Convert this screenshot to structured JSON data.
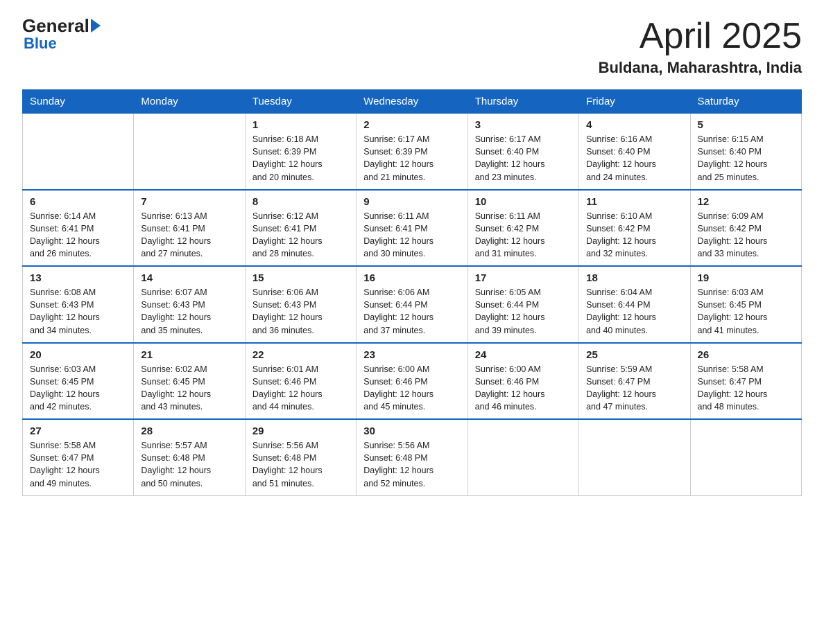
{
  "header": {
    "logo_general": "General",
    "logo_blue": "Blue",
    "title": "April 2025",
    "location": "Buldana, Maharashtra, India"
  },
  "calendar": {
    "days_of_week": [
      "Sunday",
      "Monday",
      "Tuesday",
      "Wednesday",
      "Thursday",
      "Friday",
      "Saturday"
    ],
    "weeks": [
      [
        {
          "day": "",
          "info": ""
        },
        {
          "day": "",
          "info": ""
        },
        {
          "day": "1",
          "info": "Sunrise: 6:18 AM\nSunset: 6:39 PM\nDaylight: 12 hours\nand 20 minutes."
        },
        {
          "day": "2",
          "info": "Sunrise: 6:17 AM\nSunset: 6:39 PM\nDaylight: 12 hours\nand 21 minutes."
        },
        {
          "day": "3",
          "info": "Sunrise: 6:17 AM\nSunset: 6:40 PM\nDaylight: 12 hours\nand 23 minutes."
        },
        {
          "day": "4",
          "info": "Sunrise: 6:16 AM\nSunset: 6:40 PM\nDaylight: 12 hours\nand 24 minutes."
        },
        {
          "day": "5",
          "info": "Sunrise: 6:15 AM\nSunset: 6:40 PM\nDaylight: 12 hours\nand 25 minutes."
        }
      ],
      [
        {
          "day": "6",
          "info": "Sunrise: 6:14 AM\nSunset: 6:41 PM\nDaylight: 12 hours\nand 26 minutes."
        },
        {
          "day": "7",
          "info": "Sunrise: 6:13 AM\nSunset: 6:41 PM\nDaylight: 12 hours\nand 27 minutes."
        },
        {
          "day": "8",
          "info": "Sunrise: 6:12 AM\nSunset: 6:41 PM\nDaylight: 12 hours\nand 28 minutes."
        },
        {
          "day": "9",
          "info": "Sunrise: 6:11 AM\nSunset: 6:41 PM\nDaylight: 12 hours\nand 30 minutes."
        },
        {
          "day": "10",
          "info": "Sunrise: 6:11 AM\nSunset: 6:42 PM\nDaylight: 12 hours\nand 31 minutes."
        },
        {
          "day": "11",
          "info": "Sunrise: 6:10 AM\nSunset: 6:42 PM\nDaylight: 12 hours\nand 32 minutes."
        },
        {
          "day": "12",
          "info": "Sunrise: 6:09 AM\nSunset: 6:42 PM\nDaylight: 12 hours\nand 33 minutes."
        }
      ],
      [
        {
          "day": "13",
          "info": "Sunrise: 6:08 AM\nSunset: 6:43 PM\nDaylight: 12 hours\nand 34 minutes."
        },
        {
          "day": "14",
          "info": "Sunrise: 6:07 AM\nSunset: 6:43 PM\nDaylight: 12 hours\nand 35 minutes."
        },
        {
          "day": "15",
          "info": "Sunrise: 6:06 AM\nSunset: 6:43 PM\nDaylight: 12 hours\nand 36 minutes."
        },
        {
          "day": "16",
          "info": "Sunrise: 6:06 AM\nSunset: 6:44 PM\nDaylight: 12 hours\nand 37 minutes."
        },
        {
          "day": "17",
          "info": "Sunrise: 6:05 AM\nSunset: 6:44 PM\nDaylight: 12 hours\nand 39 minutes."
        },
        {
          "day": "18",
          "info": "Sunrise: 6:04 AM\nSunset: 6:44 PM\nDaylight: 12 hours\nand 40 minutes."
        },
        {
          "day": "19",
          "info": "Sunrise: 6:03 AM\nSunset: 6:45 PM\nDaylight: 12 hours\nand 41 minutes."
        }
      ],
      [
        {
          "day": "20",
          "info": "Sunrise: 6:03 AM\nSunset: 6:45 PM\nDaylight: 12 hours\nand 42 minutes."
        },
        {
          "day": "21",
          "info": "Sunrise: 6:02 AM\nSunset: 6:45 PM\nDaylight: 12 hours\nand 43 minutes."
        },
        {
          "day": "22",
          "info": "Sunrise: 6:01 AM\nSunset: 6:46 PM\nDaylight: 12 hours\nand 44 minutes."
        },
        {
          "day": "23",
          "info": "Sunrise: 6:00 AM\nSunset: 6:46 PM\nDaylight: 12 hours\nand 45 minutes."
        },
        {
          "day": "24",
          "info": "Sunrise: 6:00 AM\nSunset: 6:46 PM\nDaylight: 12 hours\nand 46 minutes."
        },
        {
          "day": "25",
          "info": "Sunrise: 5:59 AM\nSunset: 6:47 PM\nDaylight: 12 hours\nand 47 minutes."
        },
        {
          "day": "26",
          "info": "Sunrise: 5:58 AM\nSunset: 6:47 PM\nDaylight: 12 hours\nand 48 minutes."
        }
      ],
      [
        {
          "day": "27",
          "info": "Sunrise: 5:58 AM\nSunset: 6:47 PM\nDaylight: 12 hours\nand 49 minutes."
        },
        {
          "day": "28",
          "info": "Sunrise: 5:57 AM\nSunset: 6:48 PM\nDaylight: 12 hours\nand 50 minutes."
        },
        {
          "day": "29",
          "info": "Sunrise: 5:56 AM\nSunset: 6:48 PM\nDaylight: 12 hours\nand 51 minutes."
        },
        {
          "day": "30",
          "info": "Sunrise: 5:56 AM\nSunset: 6:48 PM\nDaylight: 12 hours\nand 52 minutes."
        },
        {
          "day": "",
          "info": ""
        },
        {
          "day": "",
          "info": ""
        },
        {
          "day": "",
          "info": ""
        }
      ]
    ]
  }
}
